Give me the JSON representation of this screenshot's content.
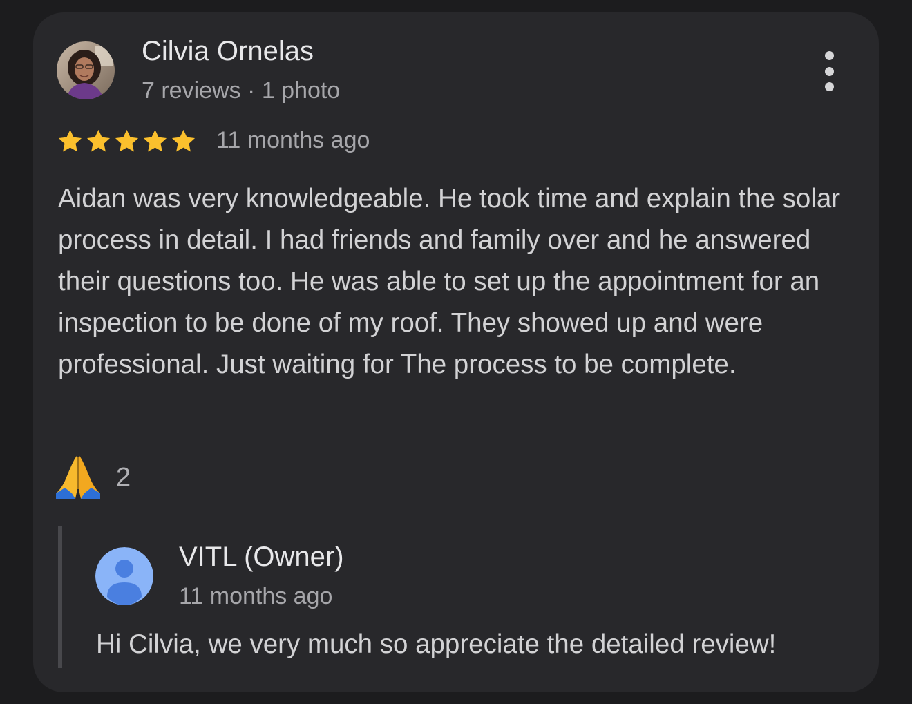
{
  "review": {
    "reviewer_name": "Cilvia Ornelas",
    "reviewer_meta": "7 reviews · 1 photo",
    "rating": 5,
    "rating_max": 5,
    "time": "11 months ago",
    "text": "Aidan was very knowledgeable. He took time and explain the solar process in detail. I had friends and family over and he answered their questions too. He was able to set up the appointment for an inspection to be done of my roof. They showed up and were professional. Just waiting for The process to be complete.",
    "reaction_icon": "folded-hands-icon",
    "reaction_count": "2"
  },
  "owner_response": {
    "name": "VITL (Owner)",
    "time": "11 months ago",
    "text": "Hi Cilvia, we very much so appreciate the detailed review!"
  },
  "icons": {
    "more_options": "more-vertical-icon",
    "star": "star-icon",
    "owner_avatar": "default-person-avatar-icon"
  },
  "colors": {
    "card_background": "#28282b",
    "page_background": "#1c1c1e",
    "star": "#fbc02d",
    "owner_avatar_background": "#8ab4f8",
    "owner_avatar_figure": "#4a7fe0"
  }
}
